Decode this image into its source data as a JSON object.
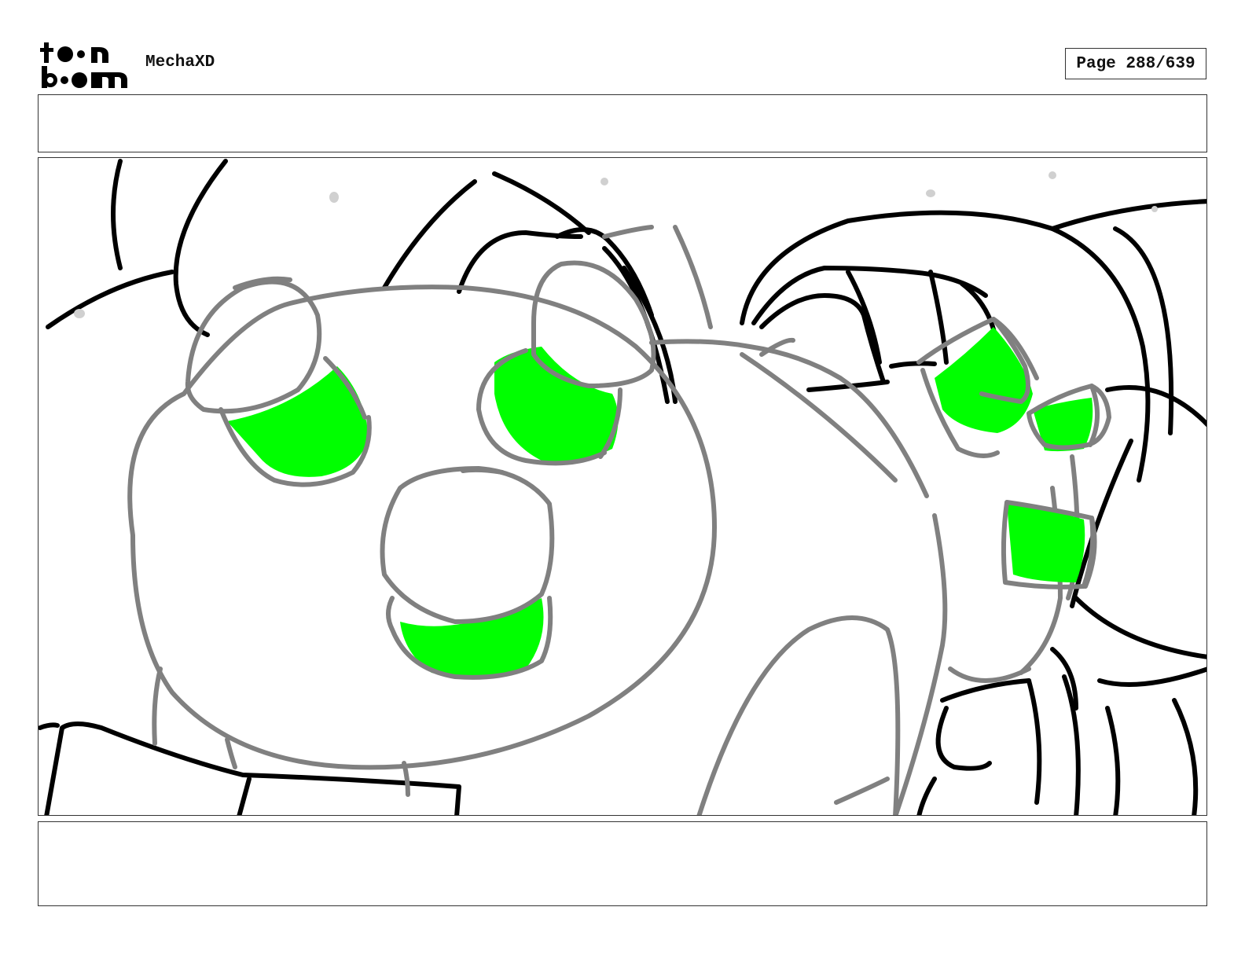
{
  "header": {
    "logo": {
      "line1": "toon",
      "line2": "boom"
    },
    "project_title": "MechaXD",
    "page_label": "Page 288/639"
  },
  "panel": {
    "colors": {
      "ink": "#000000",
      "rough": "#808080",
      "glow": "#00ff00"
    }
  },
  "notes": {
    "top": "",
    "bottom": ""
  }
}
